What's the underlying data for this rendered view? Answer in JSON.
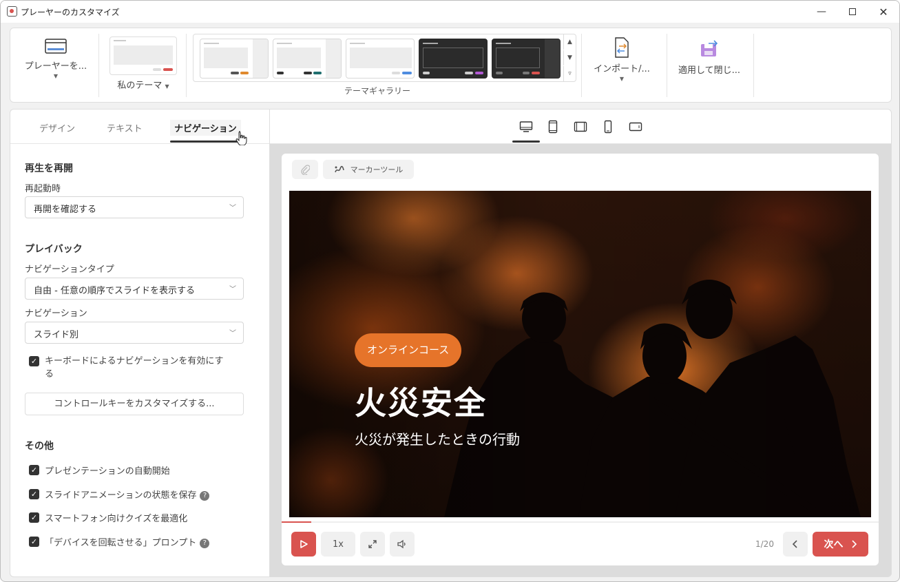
{
  "window": {
    "title": "プレーヤーのカスタマイズ"
  },
  "ribbon": {
    "player_label": "プレーヤーを...",
    "my_theme_label": "私のテーマ",
    "gallery_label": "テーマギャラリー",
    "import_label": "インポート/...",
    "apply_label": "適用して閉じ..."
  },
  "tabs": [
    {
      "label": "デザイン"
    },
    {
      "label": "テキスト"
    },
    {
      "label": "ナビゲーション"
    }
  ],
  "resume": {
    "section_title": "再生を再開",
    "restart_label": "再起動時",
    "restart_value": "再開を確認する"
  },
  "playback": {
    "section_title": "プレイバック",
    "nav_type_label": "ナビゲーションタイプ",
    "nav_type_value": "自由 - 任意の順序でスライドを表示する",
    "nav_label": "ナビゲーション",
    "nav_value": "スライド別",
    "keyboard_label_1": "キーボードによるナビゲーションを有効にす",
    "keyboard_label_2": "る",
    "customize_keys_label": "コントロールキーをカスタマイズする..."
  },
  "other": {
    "section_title": "その他",
    "items": [
      {
        "label": "プレゼンテーションの自動開始",
        "checked": true,
        "help": false
      },
      {
        "label": "スライドアニメーションの状態を保存",
        "checked": true,
        "help": true
      },
      {
        "label": "スマートフォン向けクイズを最適化",
        "checked": true,
        "help": false
      },
      {
        "label": "「デバイスを回転させる」プロンプト",
        "checked": true,
        "help": true
      }
    ]
  },
  "preview": {
    "marker_tool_label": "マーカーツール",
    "slide_badge": "オンラインコース",
    "slide_title": "火災安全",
    "slide_subtitle": "火災が発生したときの行動",
    "speed_label": "1x",
    "pager": "1/20",
    "next_label": "次へ",
    "progress_fraction": 0.05
  },
  "colors": {
    "accent": "#d9534f",
    "badge": "#e6742a"
  }
}
